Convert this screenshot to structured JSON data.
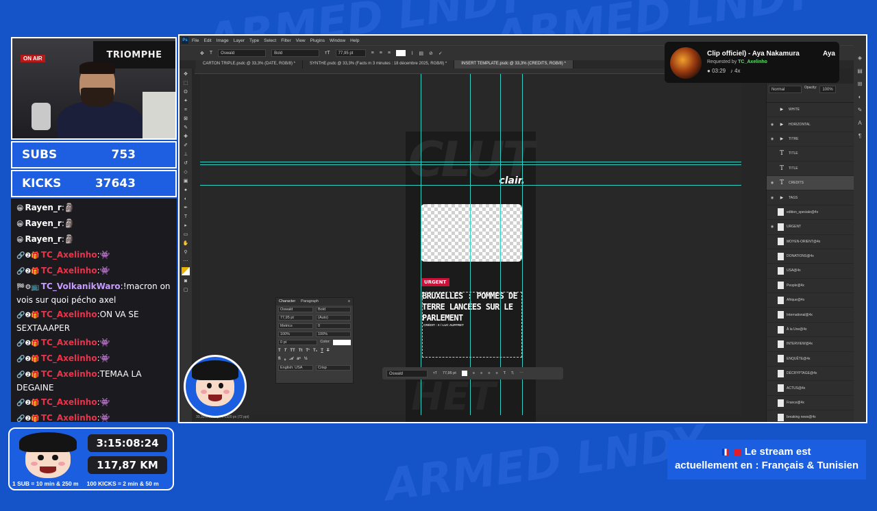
{
  "stats": {
    "subs_label": "SUBS",
    "subs_value": "753",
    "kicks_label": "KICKS",
    "kicks_value": "37643"
  },
  "webcam": {
    "banner": "TRIOMPHE",
    "on_air": "ON AIR"
  },
  "chat": [
    {
      "user": "Rayen_r",
      "sep": ":",
      "msg": "🗿",
      "color": "#ffffff",
      "icons": "😀"
    },
    {
      "user": "Rayen_r",
      "sep": ":",
      "msg": "🗿",
      "color": "#ffffff",
      "icons": "😀"
    },
    {
      "user": "Rayen_r",
      "sep": ":",
      "msg": "🗿",
      "color": "#ffffff",
      "icons": "😀"
    },
    {
      "user": "TC_Axelinho",
      "sep": ":",
      "msg": "👾",
      "color": "#e8344a",
      "icons": "🔗❷🎁"
    },
    {
      "user": "TC_Axelinho",
      "sep": ":",
      "msg": "👾",
      "color": "#e8344a",
      "icons": "🔗❷🎁"
    },
    {
      "user": "TC_VolkanikWaro",
      "sep": ":",
      "msg": "!macron on vois sur quoi pécho axel",
      "color": "#c79bff",
      "icons": "🏁⚙📺"
    },
    {
      "user": "TC_Axelinho",
      "sep": ":",
      "msg": "ON VA SE SEXTAAAPER",
      "color": "#e8344a",
      "icons": "🔗❷🎁"
    },
    {
      "user": "TC_Axelinho",
      "sep": ":",
      "msg": "👾",
      "color": "#e8344a",
      "icons": "🔗❷🎁"
    },
    {
      "user": "TC_Axelinho",
      "sep": ":",
      "msg": "👾",
      "color": "#e8344a",
      "icons": "🔗❷🎁"
    },
    {
      "user": "TC_Axelinho",
      "sep": ":",
      "msg": "TEMAA LA DEGAINE",
      "color": "#e8344a",
      "icons": "🔗❷🎁"
    },
    {
      "user": "TC_Axelinho",
      "sep": ":",
      "msg": "👾",
      "color": "#e8344a",
      "icons": "🔗❷🎁"
    },
    {
      "user": "TC_Axelinho",
      "sep": ":",
      "msg": "👾",
      "color": "#e8344a",
      "icons": "🔗❷🎁"
    }
  ],
  "photoshop": {
    "menu": [
      "File",
      "Edit",
      "Image",
      "Layer",
      "Type",
      "Select",
      "Filter",
      "View",
      "Plugins",
      "Window",
      "Help"
    ],
    "options": {
      "font": "Oswald",
      "weight": "Bold",
      "size": "77,95 pt"
    },
    "tabs": [
      "CARTON TRIPLE.psdc @ 33,3% (DATE, RGB/8) *",
      "SYNTHE.psdc @ 33,3% (Facts m 3 minutes : 18 décembre 2025, RGB/8) *",
      "INSERT TEMPLATE.psdc @ 33,3% (CREDITS, RGB/8) *"
    ],
    "doc": {
      "logo": "clair.",
      "tag": "URGENT",
      "headline": "BRUXELLES : POMMES DE TERRE LANCÉES SUR LE PARLEMENT",
      "credit": "CRÉDIT : X / LUC AUFFRET"
    },
    "character_panel": {
      "tab1": "Character",
      "tab2": "Paragraph",
      "font": "Oswald",
      "weight": "Bold",
      "size": "77,95 pt",
      "leading": "(Auto)",
      "kerning": "Metrics",
      "tracking": "0",
      "vscale": "100%",
      "hscale": "100%",
      "baseline": "0 pt",
      "color_label": "Color:",
      "language": "English: USA",
      "aa": "Crisp"
    },
    "context_bar": {
      "font": "Oswald",
      "size": "77,95 pt"
    },
    "status": "33,33%    1080 px x 1920 px (72 ppi)",
    "layers": {
      "blend": "Normal",
      "opacity_label": "Opacity:",
      "opacity": "100%",
      "lock_label": "Lock:",
      "fill_label": "Fill:",
      "fill": "100%",
      "rows": [
        {
          "name": "WHITE",
          "kind": "group",
          "visible": false,
          "selected": false
        },
        {
          "name": "HORIZONTAL",
          "kind": "group",
          "visible": true,
          "selected": false
        },
        {
          "name": "TITRE",
          "kind": "group",
          "visible": true,
          "selected": false
        },
        {
          "name": "TITLE",
          "kind": "text",
          "visible": false,
          "selected": false
        },
        {
          "name": "TITLE",
          "kind": "text",
          "visible": false,
          "selected": false
        },
        {
          "name": "CREDITS",
          "kind": "text",
          "visible": true,
          "selected": true
        },
        {
          "name": "TAGS",
          "kind": "group",
          "visible": true,
          "selected": false
        },
        {
          "name": "edition_speciale@4x",
          "kind": "image",
          "visible": false,
          "selected": false
        },
        {
          "name": "URGENT",
          "kind": "image",
          "visible": true,
          "selected": false
        },
        {
          "name": "MOYEN-ORIENT@4x",
          "kind": "image",
          "visible": false,
          "selected": false
        },
        {
          "name": "DONATIONS@4x",
          "kind": "image",
          "visible": false,
          "selected": false
        },
        {
          "name": "USA@4x",
          "kind": "image",
          "visible": false,
          "selected": false
        },
        {
          "name": "People@4x",
          "kind": "image",
          "visible": false,
          "selected": false
        },
        {
          "name": "Afrique@4x",
          "kind": "image",
          "visible": false,
          "selected": false
        },
        {
          "name": "International@4x",
          "kind": "image",
          "visible": false,
          "selected": false
        },
        {
          "name": "À la Une@4x",
          "kind": "image",
          "visible": false,
          "selected": false
        },
        {
          "name": "INTERVIEW@4x",
          "kind": "image",
          "visible": false,
          "selected": false
        },
        {
          "name": "ENQUÊTE@4x",
          "kind": "image",
          "visible": false,
          "selected": false
        },
        {
          "name": "DÉCRYPTAGE@4x",
          "kind": "image",
          "visible": false,
          "selected": false
        },
        {
          "name": "ACTUS@4x",
          "kind": "image",
          "visible": false,
          "selected": false
        },
        {
          "name": "France@4x",
          "kind": "image",
          "visible": false,
          "selected": false
        },
        {
          "name": "breaking news@4x",
          "kind": "image",
          "visible": false,
          "selected": false
        }
      ]
    }
  },
  "song": {
    "title": "Clip officiel) - Aya Nakamura",
    "artist_tail": "Aya",
    "requested_by_label": "Requested by",
    "requested_by": "TC_Axelinho",
    "duration": "03:29",
    "multiplier": "4x"
  },
  "timers": {
    "time": "3:15:08:24",
    "distance": "117,87 KM",
    "rule1": "1 SUB = 10 min & 250 m",
    "rule2": "100 KICKS = 2 min & 50 m"
  },
  "language_notice": {
    "line1": "Le stream est",
    "line2": "actuellement en : Français & Tunisien"
  },
  "colors": {
    "brand_blue": "#1b5fe0",
    "guide": "#35d1c4",
    "urgent": "#c8123a",
    "requester": "#5ee36a"
  }
}
